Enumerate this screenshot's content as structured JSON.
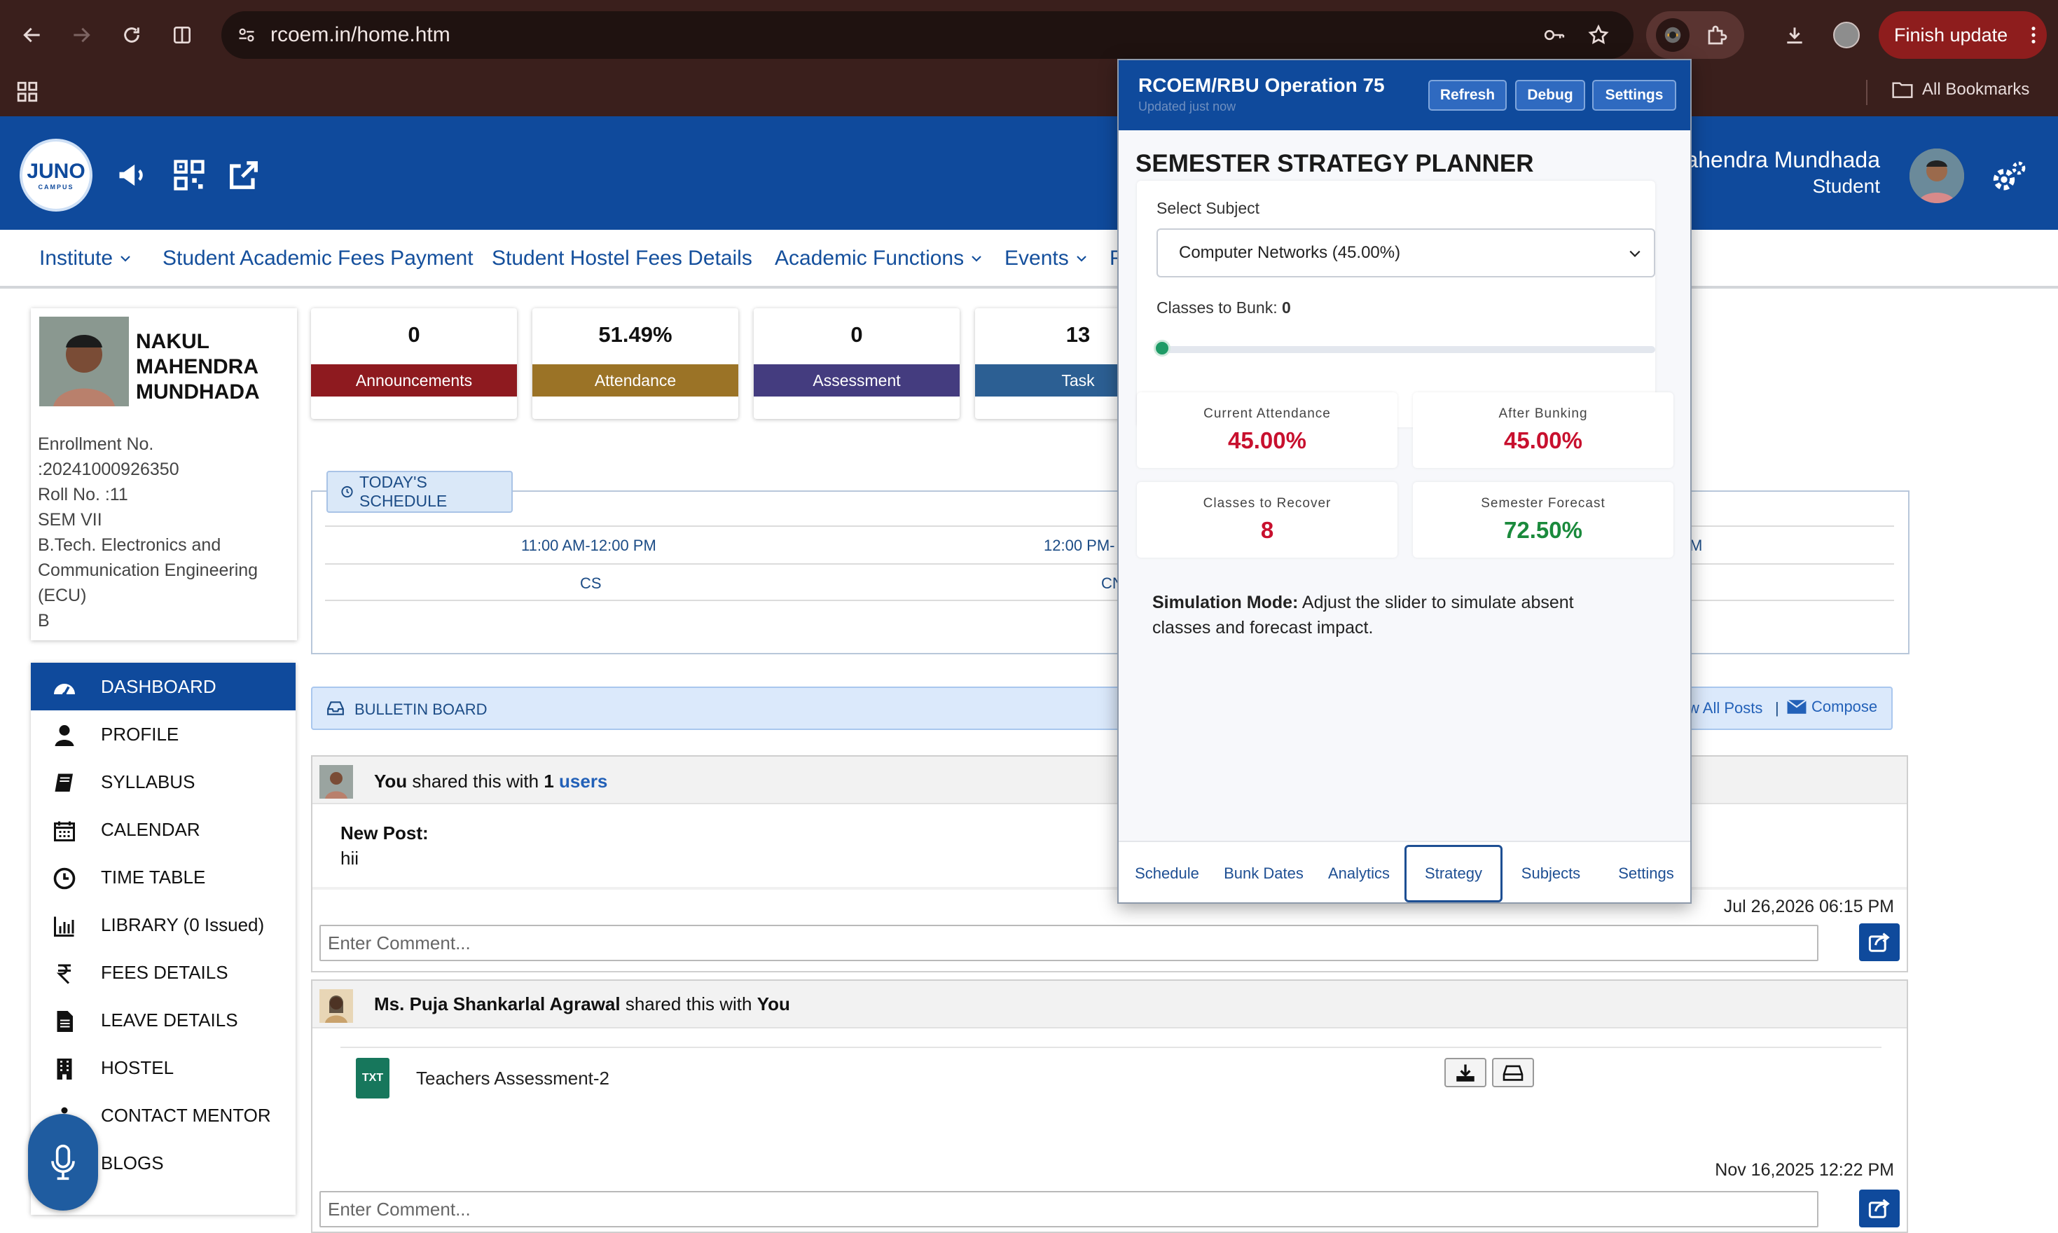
{
  "browser": {
    "url": "rcoem.in/home.htm",
    "finish_update_label": "Finish update",
    "all_bookmarks_label": "All Bookmarks"
  },
  "header": {
    "logo_text": "JUNO",
    "logo_sub": "CAMPUS",
    "user_name": "Mahendra Mundhada",
    "user_role": "Student"
  },
  "menu": {
    "items": [
      {
        "label": "Institute",
        "dropdown": true
      },
      {
        "label": "Student Academic Fees Payment",
        "dropdown": false
      },
      {
        "label": "Student Hostel Fees Details",
        "dropdown": false
      },
      {
        "label": "Academic Functions",
        "dropdown": true
      },
      {
        "label": "Events",
        "dropdown": true
      },
      {
        "label": "F",
        "dropdown": false
      }
    ]
  },
  "profile": {
    "name_line1": "NAKUL",
    "name_line2": "MAHENDRA",
    "name_line3": "MUNDHADA",
    "info": [
      "Enrollment No.",
      ":20241000926350",
      "Roll No. :11",
      "SEM VII",
      "B.Tech. Electronics and",
      "Communication Engineering",
      "(ECU)",
      "B"
    ]
  },
  "stats": [
    {
      "value": "0",
      "label": "Announcements",
      "color": "#8e1a1f"
    },
    {
      "value": "51.49%",
      "label": "Attendance",
      "color": "#9b7326"
    },
    {
      "value": "0",
      "label": "Assessment",
      "color": "#443c7f"
    },
    {
      "value": "13",
      "label": "Task",
      "color": "#2c5f93"
    }
  ],
  "schedule": {
    "tab_label": "TODAY'S SCHEDULE",
    "times": [
      "11:00 AM-12:00 PM",
      "12:00 PM-",
      "M"
    ],
    "subjects": [
      "CS",
      "CN"
    ]
  },
  "sidebar": {
    "items": [
      {
        "label": "DASHBOARD",
        "icon": "dashboard-icon",
        "active": true
      },
      {
        "label": "PROFILE",
        "icon": "user-icon",
        "active": false
      },
      {
        "label": "SYLLABUS",
        "icon": "book-icon",
        "active": false
      },
      {
        "label": "CALENDAR",
        "icon": "calendar-icon",
        "active": false
      },
      {
        "label": "TIME TABLE",
        "icon": "clock-icon",
        "active": false
      },
      {
        "label": "LIBRARY (0 Issued)",
        "icon": "bar-chart-icon",
        "active": false
      },
      {
        "label": "FEES DETAILS",
        "icon": "rupee-icon",
        "active": false
      },
      {
        "label": "LEAVE DETAILS",
        "icon": "document-icon",
        "active": false
      },
      {
        "label": "HOSTEL",
        "icon": "building-icon",
        "active": false
      },
      {
        "label": "CONTACT MENTOR",
        "icon": "contact-icon",
        "active": false
      },
      {
        "label": "BLOGS",
        "icon": "blog-icon",
        "active": false
      }
    ]
  },
  "bulletin": {
    "title": "BULLETIN BOARD",
    "view_all": "w All Posts",
    "separator": "|",
    "compose": "Compose"
  },
  "posts": [
    {
      "author": "You",
      "shared_text": "shared this with",
      "count": "1",
      "target": "users",
      "body_title": "New Post:",
      "body_text": "hii",
      "timestamp": "Jul 26,2026 06:15 PM",
      "comment_placeholder": "Enter Comment..."
    },
    {
      "author": "Ms. Puja Shankarlal Agrawal",
      "shared_text": "shared this with",
      "target": "You",
      "file_type": "TXT",
      "file_name": "Teachers Assessment-2",
      "timestamp": "Nov 16,2025 12:22 PM",
      "comment_placeholder": "Enter Comment..."
    }
  ],
  "popup": {
    "title": "RCOEM/RBU Operation 75",
    "subtitle": "Updated just now",
    "buttons": [
      "Refresh",
      "Debug",
      "Settings"
    ],
    "heading": "SEMESTER STRATEGY PLANNER",
    "select_label": "Select Subject",
    "select_value": "Computer Networks (45.00%)",
    "bunk_label": "Classes to Bunk:",
    "bunk_value": "0",
    "slider_value": 0,
    "metrics": [
      {
        "label": "Current Attendance",
        "value": "45.00%",
        "color": "#c8102e"
      },
      {
        "label": "After Bunking",
        "value": "45.00%",
        "color": "#c8102e"
      },
      {
        "label": "Classes to Recover",
        "value": "8",
        "color": "#c8102e"
      },
      {
        "label": "Semester Forecast",
        "value": "72.50%",
        "color": "#1a8a3c"
      }
    ],
    "sim_bold": "Simulation Mode:",
    "sim_text": "Adjust the slider to simulate absent classes and forecast impact.",
    "tabs": [
      "Schedule",
      "Bunk Dates",
      "Analytics",
      "Strategy",
      "Subjects",
      "Settings"
    ],
    "active_tab": "Strategy"
  }
}
